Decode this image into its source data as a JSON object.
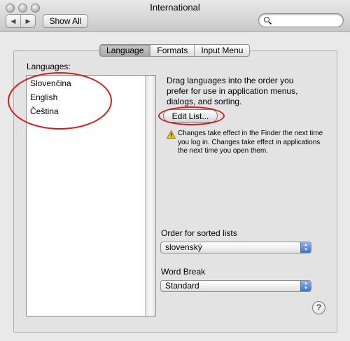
{
  "window": {
    "title": "International"
  },
  "toolbar": {
    "back_glyph": "◀",
    "forward_glyph": "▶",
    "show_all_label": "Show All",
    "search": {
      "value": "",
      "placeholder": ""
    }
  },
  "tabs": [
    {
      "label": "Language",
      "selected": true
    },
    {
      "label": "Formats",
      "selected": false
    },
    {
      "label": "Input Menu",
      "selected": false
    }
  ],
  "languages": {
    "label": "Languages:",
    "items": [
      "Slovenčina",
      "English",
      "Čeština"
    ]
  },
  "drag_description": "Drag languages into the order you prefer for use in application menus, dialogs, and sorting.",
  "edit_list_label": "Edit List...",
  "note": "Changes take effect in the Finder the next time you log in. Changes take effect in applications the next time you open them.",
  "sort_order": {
    "label": "Order for sorted lists",
    "value": "slovenský"
  },
  "word_break": {
    "label": "Word Break",
    "value": "Standard"
  },
  "help_glyph": "?",
  "colors": {
    "annotation": "#d61c1c",
    "selected_tab": "#b4b4b4",
    "help_mark": "#5a2f9a"
  }
}
